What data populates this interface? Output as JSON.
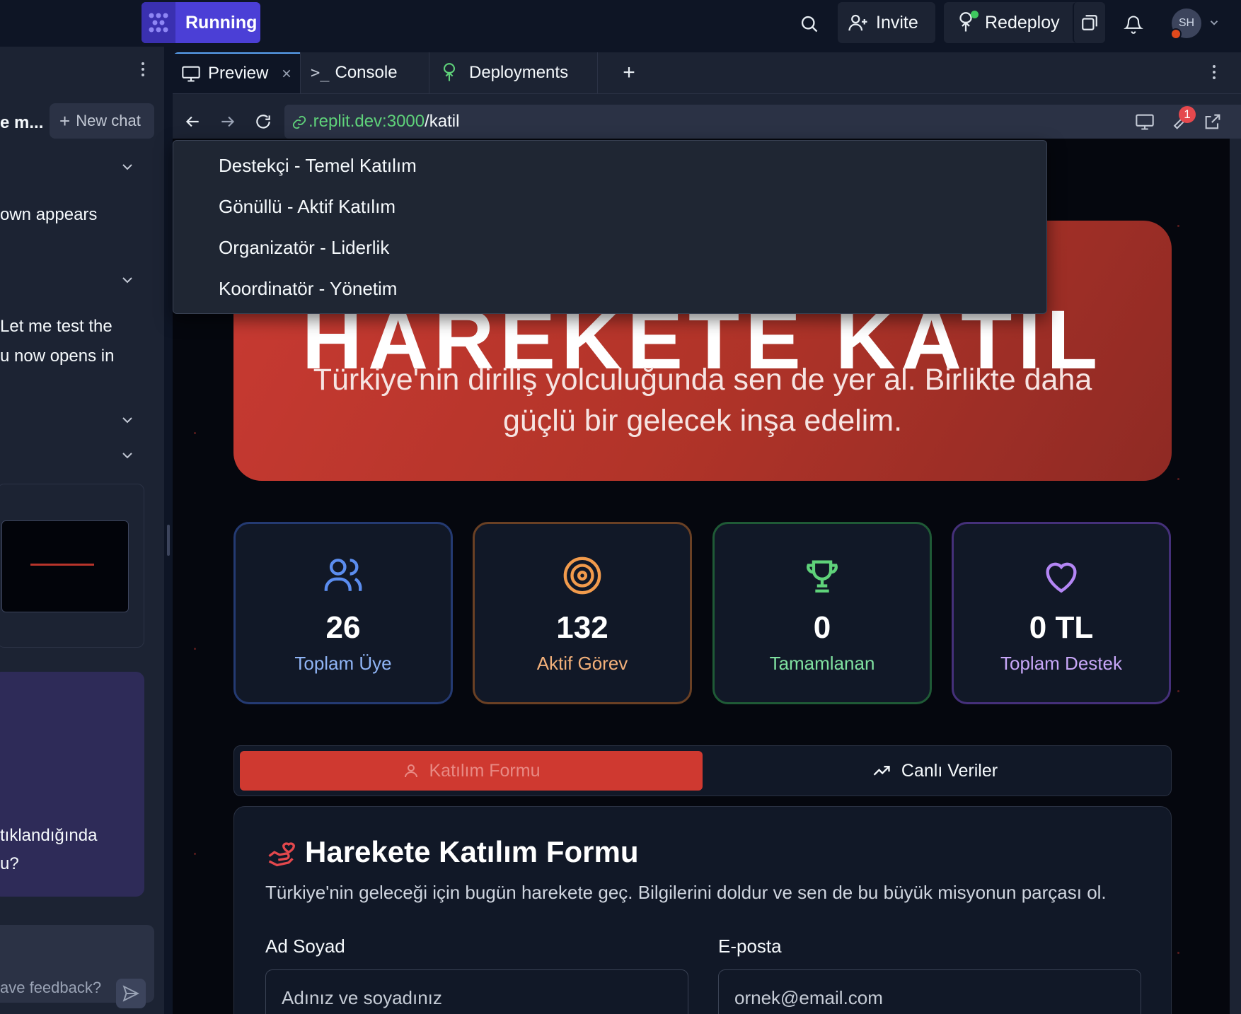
{
  "topbar": {
    "run_label": "Running",
    "invite_label": "Invite",
    "redeploy_label": "Redeploy",
    "avatar_initials": "SH"
  },
  "left_panel": {
    "truncated_title": "e m...",
    "new_chat_label": "New chat",
    "msg_line_1": "own appears",
    "msg_line_2": "Let me test the",
    "msg_line_3": "u now opens in",
    "bubble_line_1": "tıklandığında",
    "bubble_line_2": "u?",
    "input_placeholder": "ave feedback?"
  },
  "pane": {
    "tabs": [
      {
        "label": "Preview"
      },
      {
        "label": "Console"
      },
      {
        "label": "Deployments"
      }
    ],
    "url_host": ".replit.dev:3000",
    "url_path": "/katil",
    "badge_count": "1"
  },
  "dropdown": {
    "options": [
      "Destekçi - Temel Katılım",
      "Gönüllü - Aktif Katılım",
      "Organizatör - Liderlik",
      "Koordinatör - Yönetim"
    ]
  },
  "hero": {
    "title": "HAREKETE KATIL",
    "subtitle": "Türkiye'nin diriliş yolculuğunda sen de yer al. Birlikte daha güçlü bir gelecek inşa edelim."
  },
  "stats": [
    {
      "value": "26",
      "label": "Toplam Üye",
      "color": "#5b8def"
    },
    {
      "value": "132",
      "label": "Aktif Görev",
      "color": "#f29b4c"
    },
    {
      "value": "0",
      "label": "Tamamlanan",
      "color": "#5fd27a"
    },
    {
      "value": "0 TL",
      "label": "Toplam Destek",
      "color": "#b486f5"
    }
  ],
  "form_tabs": {
    "active": "Katılım Formu",
    "inactive": "Canlı Veriler"
  },
  "form": {
    "title": "Harekete Katılım Formu",
    "description": "Türkiye'nin geleceği için bugün harekete geç. Bilgilerini doldur ve sen de bu büyük misyonun parçası ol.",
    "name_label": "Ad Soyad",
    "name_placeholder": "Adınız ve soyadınız",
    "email_label": "E-posta",
    "email_placeholder": "ornek@email.com"
  },
  "colors": {
    "accent_red": "#cf3930",
    "brand_purple": "#4b3fd6"
  }
}
